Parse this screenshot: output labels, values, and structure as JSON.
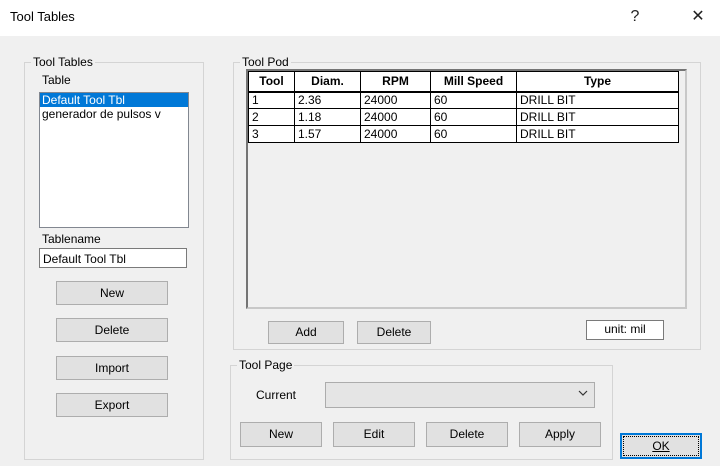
{
  "window": {
    "title": "Tool Tables",
    "help_glyph": "?",
    "close_glyph": "✕"
  },
  "tool_tables_group": {
    "label": "Tool Tables",
    "table_label": "Table",
    "tables": [
      "Default Tool Tbl",
      "generador de pulsos v"
    ],
    "selected_index": 0,
    "tablename_label": "Tablename",
    "tablename_value": "Default Tool Tbl",
    "buttons": {
      "new": "New",
      "delete": "Delete",
      "import": "Import",
      "export": "Export"
    }
  },
  "tool_pod_group": {
    "label": "Tool Pod",
    "columns": [
      "Tool",
      "Diam.",
      "RPM",
      "Mill Speed",
      "Type"
    ],
    "rows": [
      [
        "1",
        "2.36",
        "24000",
        "60",
        "DRILL BIT"
      ],
      [
        "2",
        "1.18",
        "24000",
        "60",
        "DRILL BIT"
      ],
      [
        "3",
        "1.57",
        "24000",
        "60",
        "DRILL BIT"
      ]
    ],
    "add_button": "Add",
    "delete_button": "Delete",
    "unit_text": "unit: mil"
  },
  "tool_page_group": {
    "label": "Tool Page",
    "current_label": "Current",
    "current_value": "",
    "buttons": {
      "new": "New",
      "edit": "Edit",
      "delete": "Delete",
      "apply": "Apply"
    }
  },
  "ok_button": "OK",
  "colors": {
    "selection": "#0078d7",
    "dialog_bg": "#f0f0f0"
  }
}
